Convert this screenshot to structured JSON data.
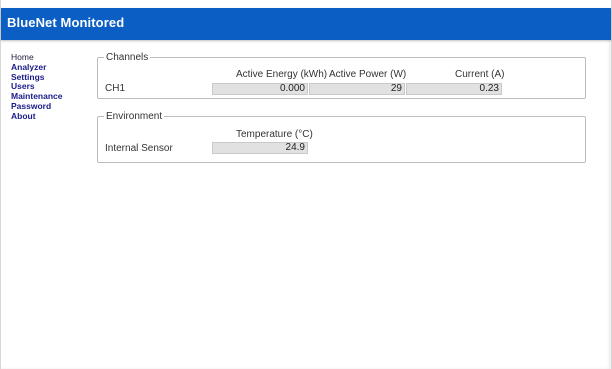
{
  "header": {
    "title": "BlueNet Monitored"
  },
  "sidebar": {
    "items": [
      {
        "label": "Home"
      },
      {
        "label": "Analyzer"
      },
      {
        "label": "Settings"
      },
      {
        "label": "Users"
      },
      {
        "label": "Maintenance"
      },
      {
        "label": "Password"
      },
      {
        "label": "About"
      }
    ]
  },
  "channels": {
    "legend": "Channels",
    "columns": [
      "Active Energy (kWh)",
      "Active Power (W)",
      "Current (A)"
    ],
    "rows": [
      {
        "label": "CH1",
        "values": [
          "0.000",
          "29",
          "0.23"
        ]
      }
    ]
  },
  "environment": {
    "legend": "Environment",
    "columns": [
      "Temperature (°C)"
    ],
    "rows": [
      {
        "label": "Internal Sensor",
        "values": [
          "24.9"
        ]
      }
    ]
  },
  "colors": {
    "header_bg": "#0a5ec4",
    "header_text": "#ffffff",
    "nav_link": "#1a1a8a",
    "value_box_bg": "#e1e1e1"
  }
}
